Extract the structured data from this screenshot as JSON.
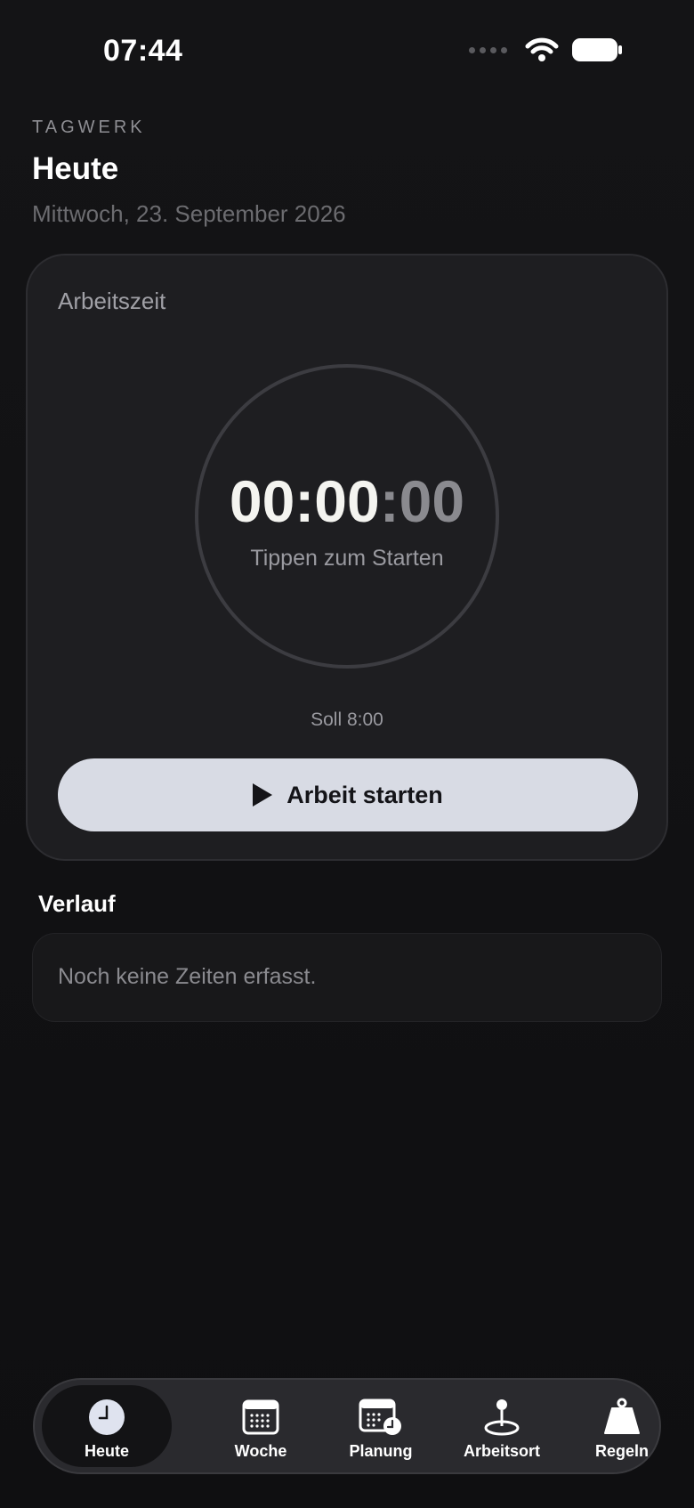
{
  "status_bar": {
    "time": "07:44"
  },
  "header": {
    "app_name": "TAGWERK",
    "title": "Heute",
    "date": "Mittwoch, 23. September 2026"
  },
  "timer_card": {
    "label": "Arbeitszeit",
    "time_main": "00:00",
    "time_seconds": ":00",
    "hint": "Tippen zum Starten",
    "target": "Soll 8:00",
    "start_button_label": "Arbeit starten"
  },
  "history": {
    "title": "Verlauf",
    "empty_text": "Noch keine Zeiten erfasst."
  },
  "tab_bar": {
    "items": [
      {
        "label": "Heute",
        "icon": "clock-icon",
        "active": true
      },
      {
        "label": "Woche",
        "icon": "calendar-icon",
        "active": false
      },
      {
        "label": "Planung",
        "icon": "calendar-clock-icon",
        "active": false
      },
      {
        "label": "Arbeitsort",
        "icon": "location-pin-icon",
        "active": false
      },
      {
        "label": "Regeln",
        "icon": "weight-icon",
        "active": false
      }
    ]
  },
  "colors": {
    "background": "#111113",
    "card": "#1e1e21",
    "button": "#d8dbe4",
    "accent_text": "#f4f4f0",
    "muted_text": "#8a8a8f"
  }
}
